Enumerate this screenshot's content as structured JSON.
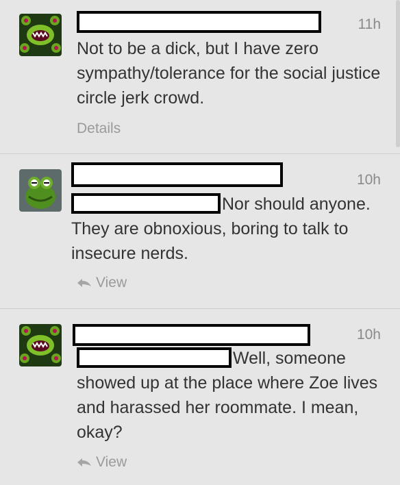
{
  "tweets": [
    {
      "time": "11h",
      "text": "Not to be a dick, but I have zero sympathy/tolerance for the social justice circle jerk crowd.",
      "meta_label": "Details"
    },
    {
      "time": "10h",
      "text": "Nor should anyone. They are obnoxious, boring to talk to insecure nerds.",
      "meta_label": "View"
    },
    {
      "time": "10h",
      "text": "Well, someone showed up at the place where Zoe lives and harassed her roommate. I mean, okay?",
      "meta_label": "View"
    }
  ],
  "colors": {
    "background": "#e6e6e6",
    "text": "#333333",
    "muted": "#9a9a9a"
  },
  "icons": [
    "monster-avatar-icon",
    "frog-avatar-icon",
    "reply-icon"
  ]
}
